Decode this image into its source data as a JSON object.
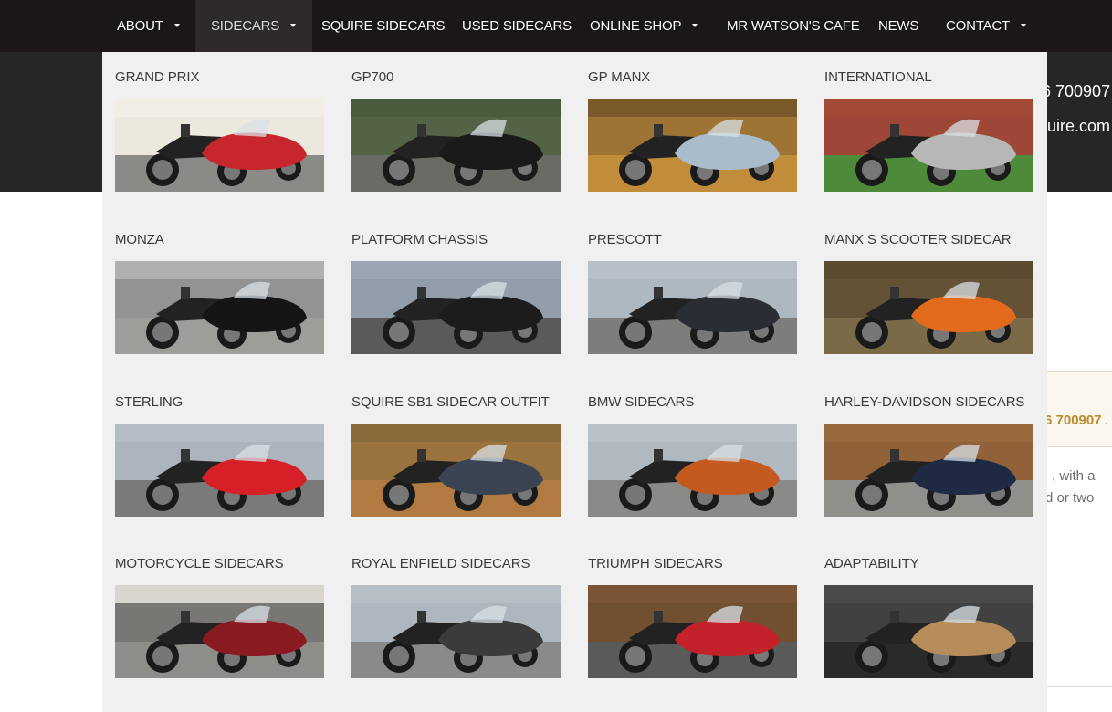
{
  "nav": {
    "items": [
      {
        "label": "ABOUT",
        "has_caret": true
      },
      {
        "label": "SIDECARS",
        "has_caret": true,
        "active": true
      },
      {
        "label": "SQUIRE SIDECARS",
        "has_caret": false
      },
      {
        "label": "USED SIDECARS",
        "has_caret": false
      },
      {
        "label": "ONLINE SHOP",
        "has_caret": true
      },
      {
        "label": "MR WATSON'S CAFE",
        "has_caret": false
      },
      {
        "label": "NEWS",
        "has_caret": false
      },
      {
        "label": "CONTACT",
        "has_caret": true
      }
    ]
  },
  "header": {
    "phone_fragment": "6 700907",
    "email_fragment": "quire.com"
  },
  "page": {
    "notice_phone_fragment": "6 700907",
    "notice_dot": ".",
    "body_line1": ", with a",
    "body_line2": "d or two"
  },
  "menu": {
    "tiles": [
      {
        "title": "GRAND PRIX",
        "bg": "#e9e3d6",
        "body": "#c7262c",
        "ground": "#8a8a86",
        "wall": "#f2eee6"
      },
      {
        "title": "GP700",
        "bg": "#5c6a4c",
        "body": "#1a1a1a",
        "ground": "#6b6b66",
        "wall": "#4a5a3c"
      },
      {
        "title": "GP MANX",
        "bg": "#b98a3d",
        "body": "#a9bccb",
        "ground": "#c18d3a",
        "wall": "#7a5a2a"
      },
      {
        "title": "INTERNATIONAL",
        "bg": "#9a4636",
        "body": "#b7b7b7",
        "ground": "#4d8a3a",
        "wall": "#a34a36"
      },
      {
        "title": "MONZA",
        "bg": "#7c7c7c",
        "body": "#151515",
        "ground": "#9d9d9a",
        "wall": "#b0b0b0"
      },
      {
        "title": "PLATFORM CHASSIS",
        "bg": "#8a97a4",
        "body": "#1c1c1c",
        "ground": "#5a5a58",
        "wall": "#9aa6b2"
      },
      {
        "title": "PRESCOTT",
        "bg": "#a7b1bb",
        "body": "#2a2d33",
        "ground": "#7d7d7b",
        "wall": "#b7c0c8"
      },
      {
        "title": "MANX S SCOOTER SIDECAR",
        "bg": "#6d5a3c",
        "body": "#e26a1c",
        "ground": "#7b6a48",
        "wall": "#5a4a30"
      },
      {
        "title": "STERLING",
        "bg": "#a6aeb8",
        "body": "#d61f26",
        "ground": "#7a7a78",
        "wall": "#b4bcc5"
      },
      {
        "title": "SQUIRE SB1 SIDECAR OUTFIT",
        "bg": "#a97a44",
        "body": "#3a4452",
        "ground": "#b07a40",
        "wall": "#8a6a3a"
      },
      {
        "title": "BMW SIDECARS",
        "bg": "#a9b1ba",
        "body": "#c45a1f",
        "ground": "#8a8a88",
        "wall": "#b9c0c8"
      },
      {
        "title": "HARLEY-DAVIDSON SIDECARS",
        "bg": "#8a5a34",
        "body": "#1e2a44",
        "ground": "#8f8f8c",
        "wall": "#9a6a3e"
      },
      {
        "title": "MOTORCYCLE SIDECARS",
        "bg": "#2a2a2a",
        "body": "#8a1a22",
        "ground": "#8d8d8a",
        "wall": "#d9d6cf"
      },
      {
        "title": "ROYAL ENFIELD SIDECARS",
        "bg": "#a7b0ba",
        "body": "#3b3b3b",
        "ground": "#8a8a88",
        "wall": "#b6bec6"
      },
      {
        "title": "TRIUMPH SIDECARS",
        "bg": "#6a4a2e",
        "body": "#c4222a",
        "ground": "#5a5a58",
        "wall": "#7a5535"
      },
      {
        "title": "ADAPTABILITY",
        "bg": "#3a3a3a",
        "body": "#b58c5a",
        "ground": "#2a2a2a",
        "wall": "#4a4a4a"
      }
    ]
  }
}
